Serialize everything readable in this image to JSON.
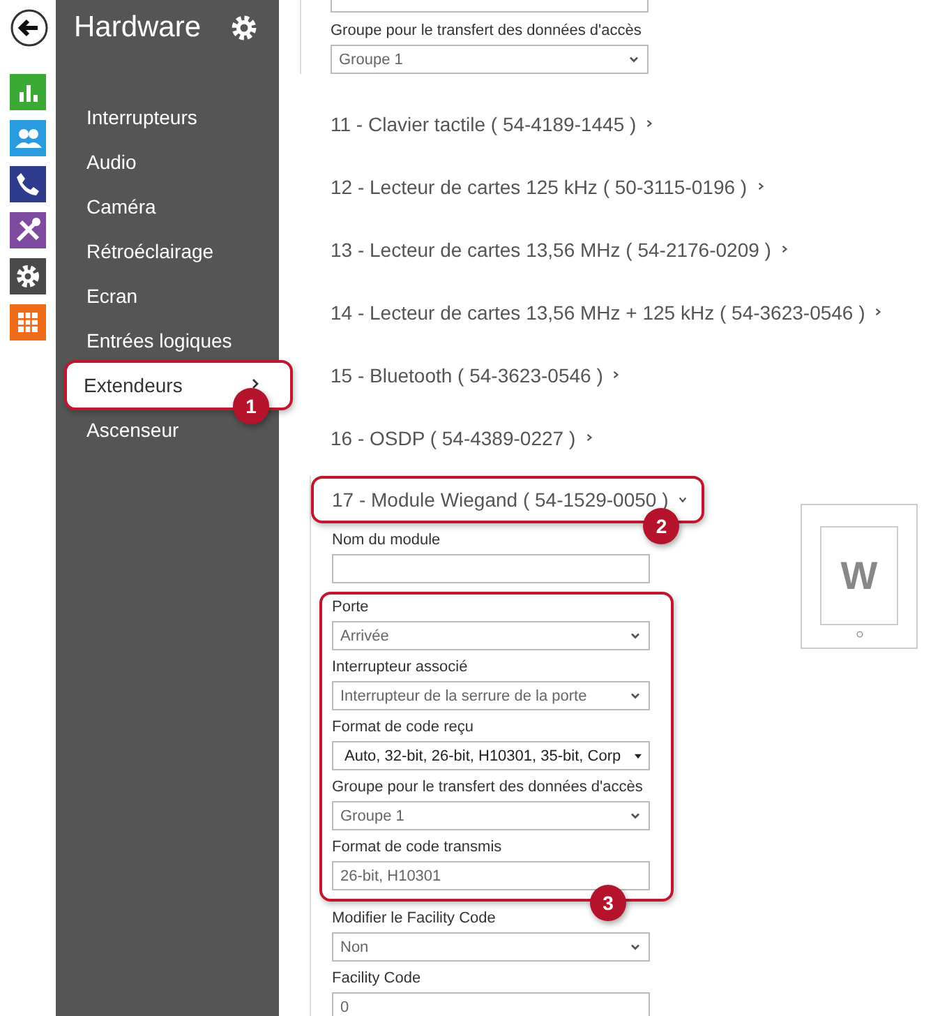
{
  "sidebar": {
    "title": "Hardware",
    "items": [
      {
        "label": "Interrupteurs",
        "selected": false
      },
      {
        "label": "Audio",
        "selected": false
      },
      {
        "label": "Caméra",
        "selected": false
      },
      {
        "label": "Rétroéclairage",
        "selected": false
      },
      {
        "label": "Ecran",
        "selected": false
      },
      {
        "label": "Entrées logiques",
        "selected": false
      },
      {
        "label": "Extendeurs",
        "selected": true,
        "callout": "1"
      },
      {
        "label": "Ascenseur",
        "selected": false
      }
    ]
  },
  "previous_module": {
    "fields": [
      {
        "kind": "select",
        "label": "Groupe pour le transfert des données d'accès",
        "value": "Groupe 1"
      }
    ]
  },
  "modules": [
    {
      "title": "11 - Clavier tactile ( 54-4189-1445 )",
      "expanded": false
    },
    {
      "title": "12 - Lecteur de cartes 125 kHz ( 50-3115-0196 )",
      "expanded": false
    },
    {
      "title": "13 - Lecteur de cartes 13,56 MHz ( 54-2176-0209 )",
      "expanded": false
    },
    {
      "title": "14 - Lecteur de cartes 13,56 MHz + 125 kHz ( 54-3623-0546 )",
      "expanded": false
    },
    {
      "title": "15 - Bluetooth ( 54-3623-0546 )",
      "expanded": false
    },
    {
      "title": "16 - OSDP ( 54-4389-0227 )",
      "expanded": false
    },
    {
      "title": "17 - Module Wiegand ( 54-1529-0050 )",
      "expanded": true,
      "callout": "2",
      "device_letter": "W",
      "field_groups": [
        {
          "fields": [
            {
              "kind": "input",
              "label": "Nom du module"
            }
          ]
        },
        {
          "callout": "3",
          "fields": [
            {
              "kind": "select",
              "label": "Porte",
              "value": "Arrivée"
            },
            {
              "kind": "select",
              "label": "Interrupteur associé",
              "value": "Interrupteur de la serrure de la porte"
            },
            {
              "kind": "multiselect",
              "label": "Format de code reçu",
              "value": "Auto, 32-bit, 26-bit, H10301, 35-bit, Corp"
            },
            {
              "kind": "select",
              "label": "Groupe pour le transfert des données d'accès",
              "value": "Groupe 1"
            },
            {
              "kind": "input",
              "label": "Format de code transmis",
              "value": "26-bit, H10301"
            }
          ]
        },
        {
          "fields": [
            {
              "kind": "select",
              "label": "Modifier le Facility Code",
              "value": "Non"
            },
            {
              "kind": "input",
              "label": "Facility Code",
              "value": "0"
            }
          ]
        }
      ]
    }
  ]
}
